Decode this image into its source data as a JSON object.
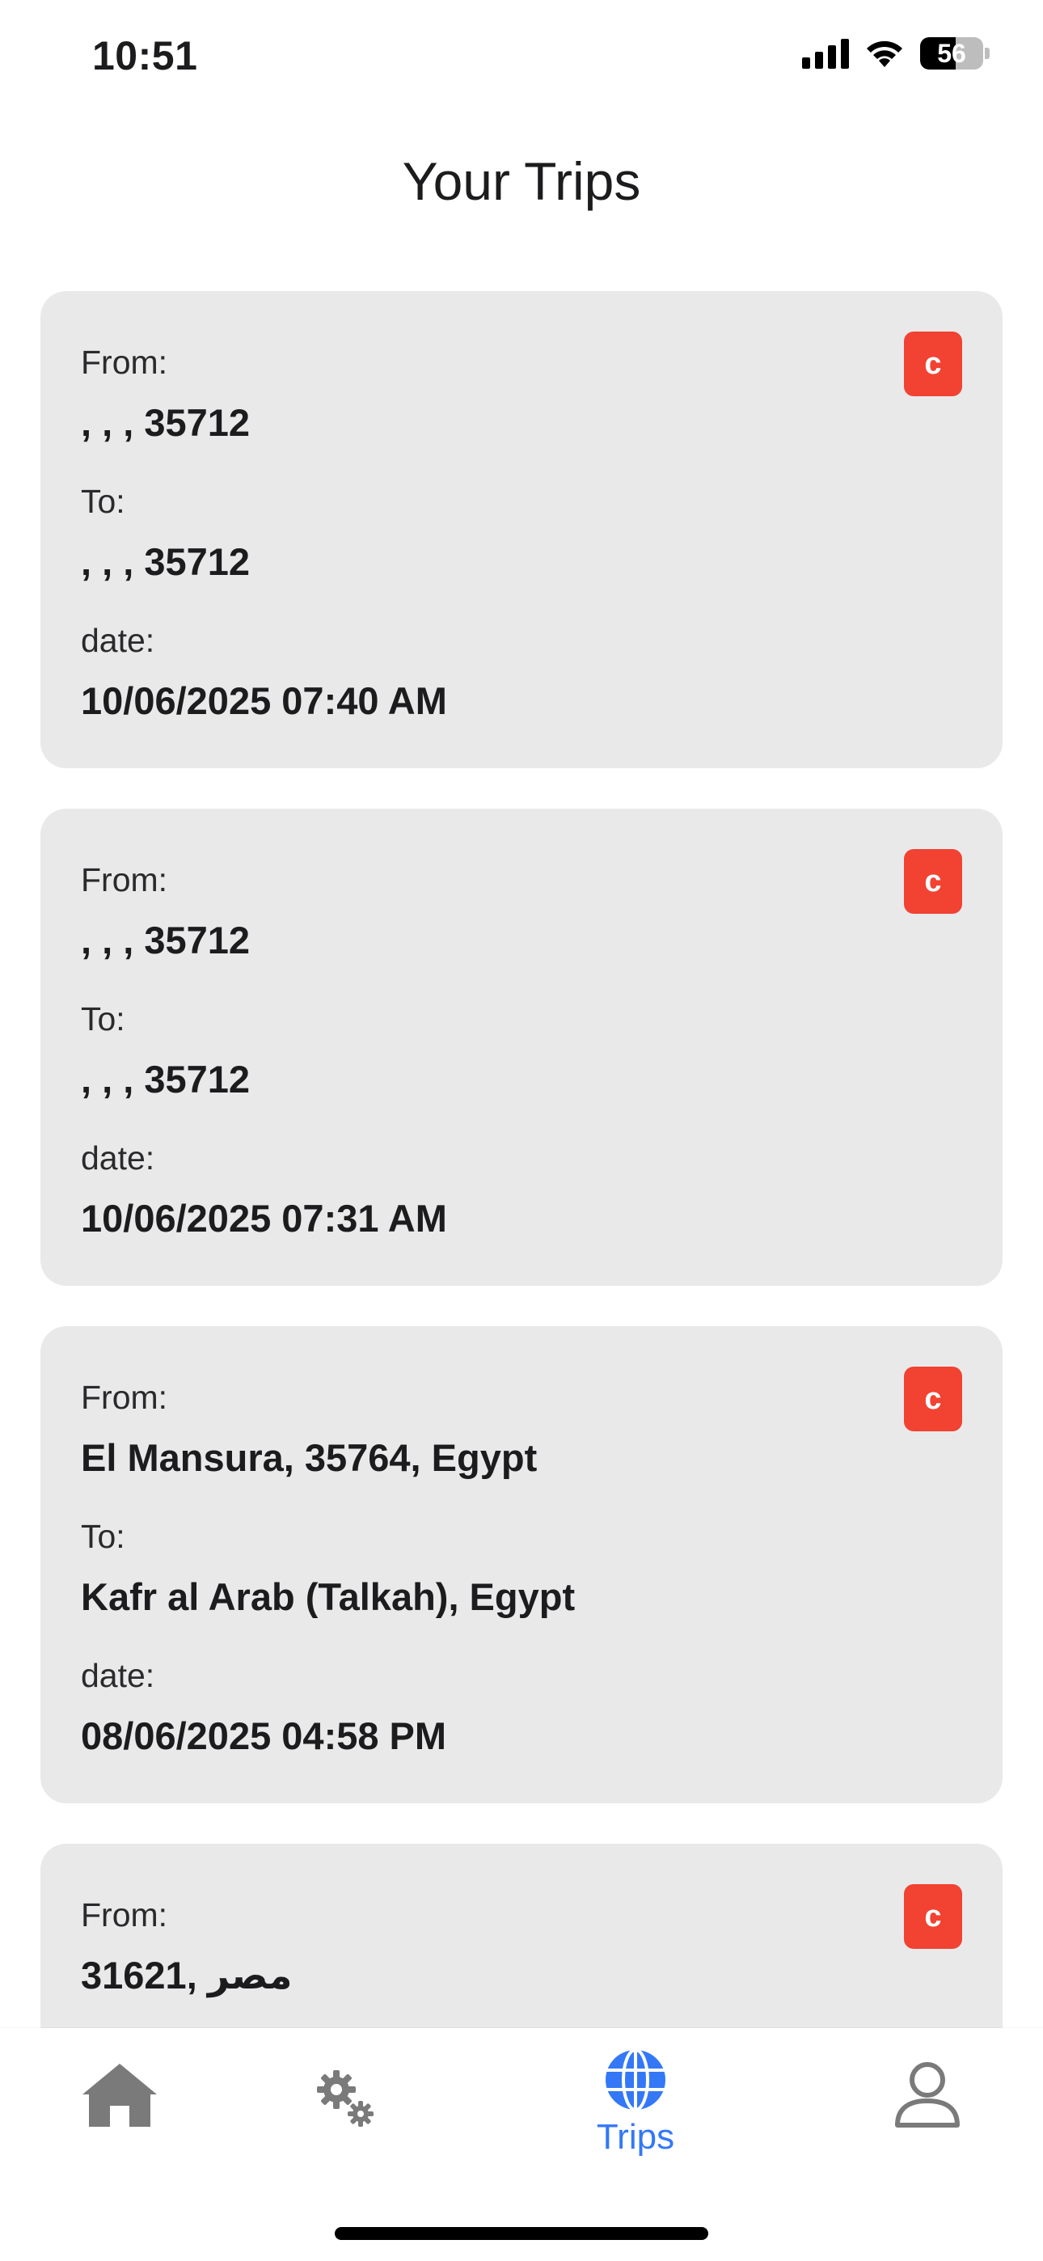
{
  "status_bar": {
    "time": "10:51",
    "battery_level": "56",
    "battery_fraction": 0.56
  },
  "page": {
    "title": "Your Trips"
  },
  "labels": {
    "from": "From:",
    "to": "To:",
    "date": "date:",
    "cancel_badge": "c"
  },
  "trips": [
    {
      "from": ", , , 35712",
      "to": ", , , 35712",
      "date": "10/06/2025 07:40 AM"
    },
    {
      "from": ", , , 35712",
      "to": ", , , 35712",
      "date": "10/06/2025 07:31 AM"
    },
    {
      "from": "El Mansura, 35764, Egypt",
      "to": "Kafr al Arab (Talkah), Egypt",
      "date": "08/06/2025 04:58 PM"
    },
    {
      "from": "31621, مصر",
      "to": "",
      "date": ""
    }
  ],
  "tab_bar": {
    "items": [
      {
        "icon": "home-icon",
        "label": ""
      },
      {
        "icon": "gears-icon",
        "label": ""
      },
      {
        "icon": "globe-icon",
        "label": "Trips",
        "active": true
      },
      {
        "icon": "user-icon",
        "label": ""
      }
    ]
  },
  "colors": {
    "accent": "#3478f6",
    "badge": "#f14232",
    "card": "#e9e9ea",
    "inactive_icon": "#7a7a7a"
  }
}
